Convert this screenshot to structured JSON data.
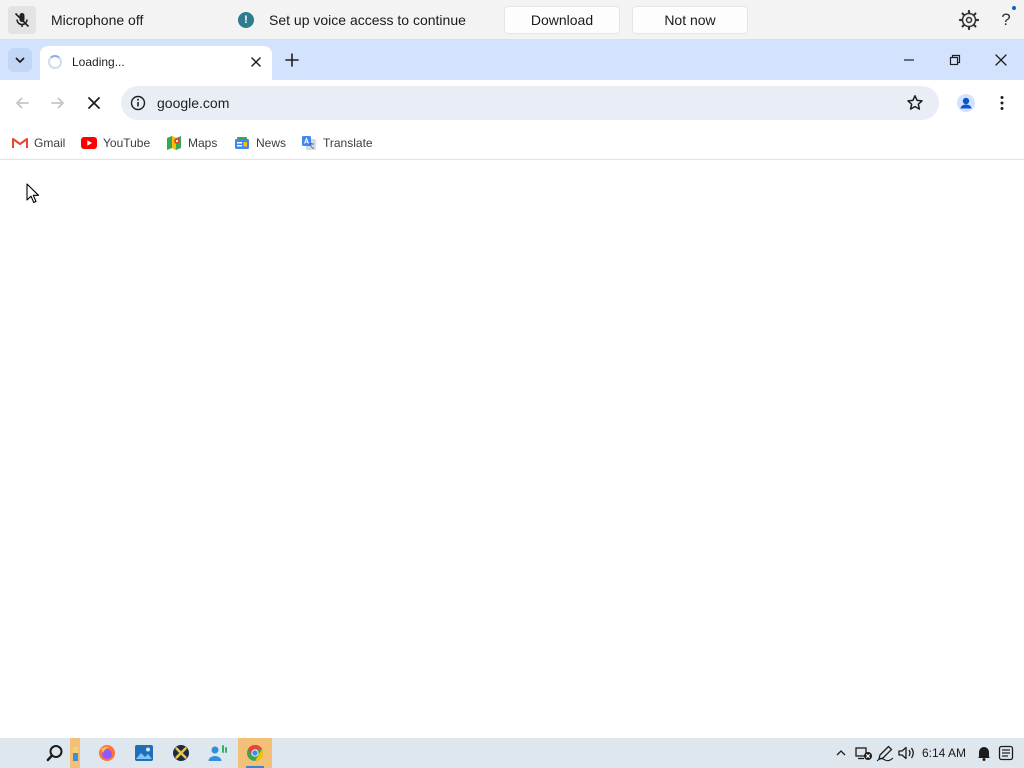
{
  "voice_access": {
    "mic_status": "Microphone off",
    "message": "Set up voice access to continue",
    "download_label": "Download",
    "not_now_label": "Not now",
    "info_glyph": "!",
    "help_glyph": "?"
  },
  "browser": {
    "tab": {
      "title": "Loading...",
      "state": "loading"
    },
    "address": "google.com",
    "bookmarks": [
      {
        "label": "Gmail",
        "icon": "gmail-icon"
      },
      {
        "label": "YouTube",
        "icon": "youtube-icon"
      },
      {
        "label": "Maps",
        "icon": "maps-icon"
      },
      {
        "label": "News",
        "icon": "news-icon"
      },
      {
        "label": "Translate",
        "icon": "translate-icon"
      }
    ]
  },
  "taskbar": {
    "apps": [
      "search-icon",
      "file-explorer-icon",
      "firefox-icon",
      "photos-icon",
      "xbox-icon",
      "people-icon",
      "chrome-icon"
    ],
    "active_app": "chrome-icon",
    "time": "6:14 AM"
  },
  "colors": {
    "tab_strip": "#d3e3fd",
    "omnibox": "#e9eef6",
    "voice_bar": "#f3f3f3",
    "taskbar": "#dfe7ee",
    "info_dot": "#2f7d8c"
  }
}
